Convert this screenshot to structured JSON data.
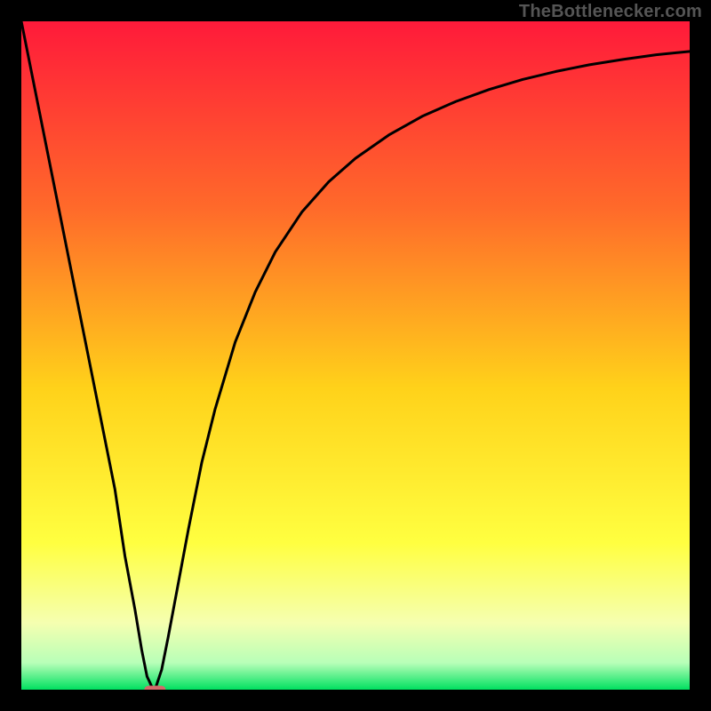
{
  "attribution": "TheBottlenecker.com",
  "colors": {
    "frame": "#000000",
    "gradient_top": "#ff1a3a",
    "gradient_mid_upper": "#ff6a2a",
    "gradient_mid": "#ffd21a",
    "gradient_mid_lower": "#ffff40",
    "gradient_low1": "#f5ffb0",
    "gradient_low2": "#b8ffb8",
    "gradient_bottom": "#00e060",
    "curve": "#000000",
    "marker": "#d46a6a"
  },
  "chart_data": {
    "type": "line",
    "title": "",
    "xlabel": "",
    "ylabel": "",
    "xlim": [
      0,
      100
    ],
    "ylim": [
      0,
      100
    ],
    "series": [
      {
        "name": "bottleneck-curve",
        "x": [
          0,
          2,
          4,
          6,
          8,
          10,
          12,
          14,
          15.5,
          17,
          18,
          18.8,
          19.5,
          20,
          21,
          22,
          23.5,
          25,
          27,
          29,
          32,
          35,
          38,
          42,
          46,
          50,
          55,
          60,
          65,
          70,
          75,
          80,
          85,
          90,
          95,
          100
        ],
        "values": [
          100,
          90,
          80,
          70,
          60,
          50,
          40,
          30,
          20,
          12,
          6,
          2,
          0.5,
          0,
          3,
          8,
          16,
          24,
          34,
          42,
          52,
          59.5,
          65.5,
          71.5,
          76,
          79.5,
          83,
          85.8,
          88,
          89.8,
          91.3,
          92.5,
          93.5,
          94.3,
          95,
          95.5
        ]
      }
    ],
    "marker": {
      "x": 20,
      "y": 0,
      "width": 3.2,
      "height": 1.2
    }
  }
}
